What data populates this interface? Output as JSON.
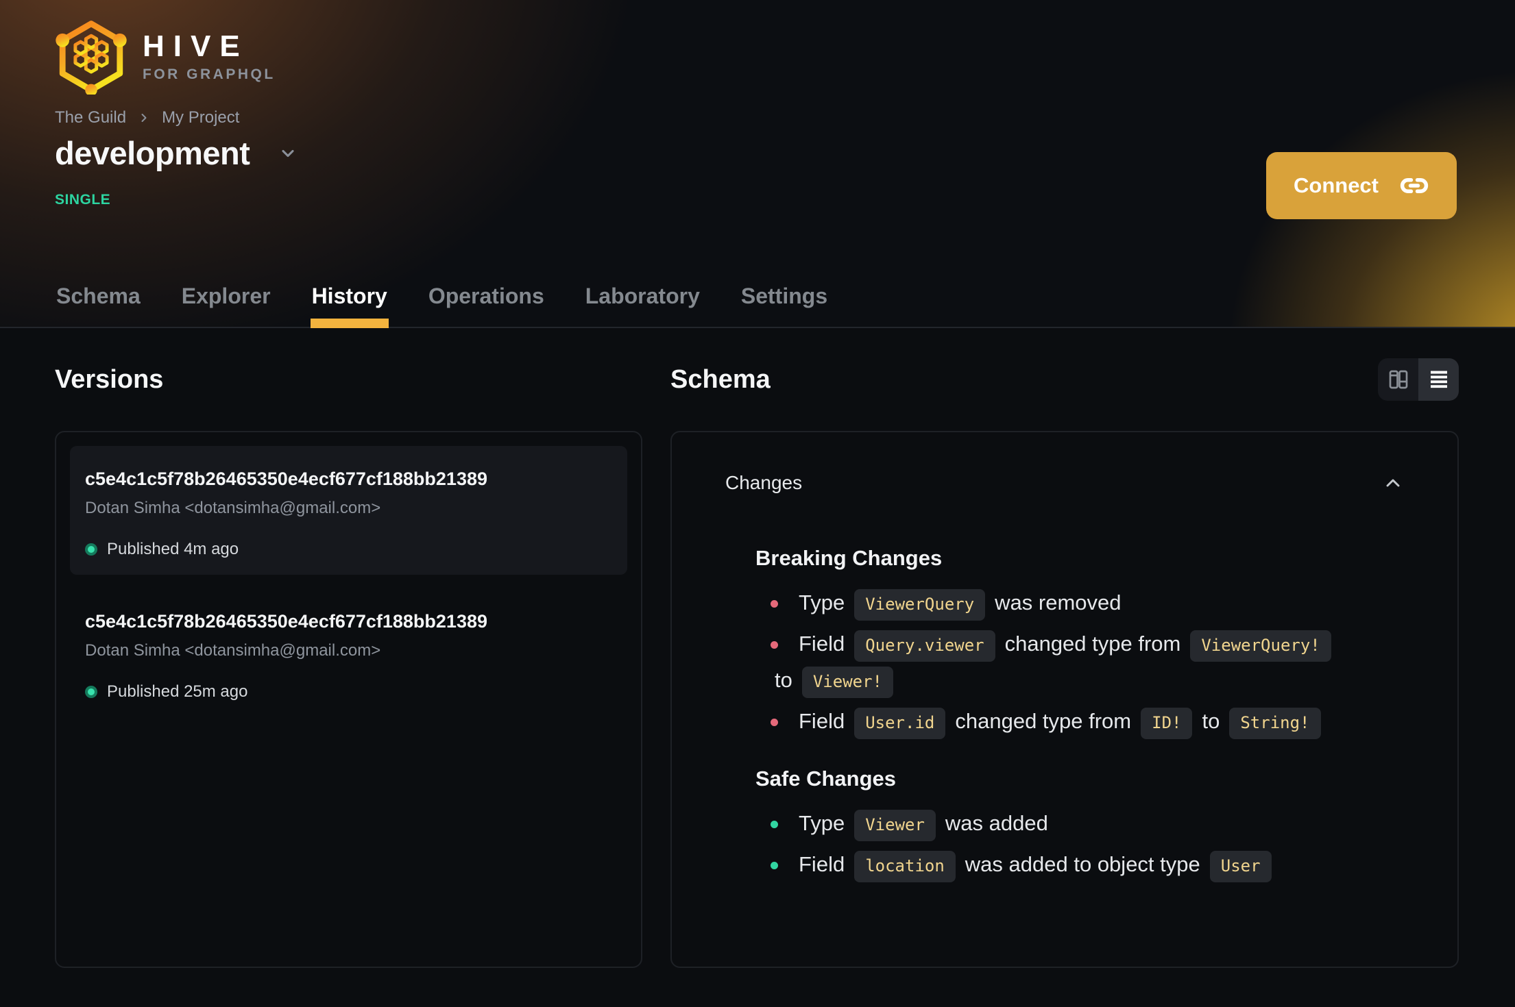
{
  "brand": {
    "name": "HIVE",
    "tagline": "FOR GRAPHQL"
  },
  "breadcrumb": {
    "org": "The Guild",
    "project": "My Project"
  },
  "target": {
    "name": "development",
    "badge": "SINGLE"
  },
  "connect": {
    "label": "Connect"
  },
  "tabs": [
    {
      "label": "Schema",
      "active": false
    },
    {
      "label": "Explorer",
      "active": false
    },
    {
      "label": "History",
      "active": true
    },
    {
      "label": "Operations",
      "active": false
    },
    {
      "label": "Laboratory",
      "active": false
    },
    {
      "label": "Settings",
      "active": false
    }
  ],
  "versions": {
    "heading": "Versions",
    "items": [
      {
        "hash": "c5e4c1c5f78b26465350e4ecf677cf188bb21389",
        "author": "Dotan Simha <dotansimha@gmail.com>",
        "status": "Published 4m ago",
        "selected": true
      },
      {
        "hash": "c5e4c1c5f78b26465350e4ecf677cf188bb21389",
        "author": "Dotan Simha <dotansimha@gmail.com>",
        "status": "Published 25m ago",
        "selected": false
      }
    ]
  },
  "schema": {
    "heading": "Schema",
    "changes_title": "Changes",
    "sections": [
      {
        "title": "Breaking Changes",
        "bullet_color": "#e5697a",
        "items": [
          [
            {
              "text": "Type"
            },
            {
              "code": "ViewerQuery"
            },
            {
              "text": "was removed"
            }
          ],
          [
            {
              "text": "Field"
            },
            {
              "code": "Query.viewer"
            },
            {
              "text": "changed type from"
            },
            {
              "code": "ViewerQuery!"
            },
            {
              "br": true
            },
            {
              "text": "to"
            },
            {
              "code": "Viewer!"
            }
          ],
          [
            {
              "text": "Field"
            },
            {
              "code": "User.id"
            },
            {
              "text": "changed type from"
            },
            {
              "code": "ID!"
            },
            {
              "text": "to"
            },
            {
              "code": "String!"
            }
          ]
        ]
      },
      {
        "title": "Safe Changes",
        "bullet_color": "#32d6a2",
        "items": [
          [
            {
              "text": "Type"
            },
            {
              "code": "Viewer"
            },
            {
              "text": "was added"
            }
          ],
          [
            {
              "text": "Field"
            },
            {
              "code": "location"
            },
            {
              "text": "was added to object type"
            },
            {
              "code": "User"
            }
          ]
        ]
      }
    ]
  },
  "colors": {
    "accent_gold": "#f2b33e",
    "connect_bg": "#d9a23a",
    "badge_green": "#2dd4a0",
    "code_text": "#f1d58e",
    "breaking_bullet": "#e5697a",
    "safe_bullet": "#32d6a2"
  }
}
